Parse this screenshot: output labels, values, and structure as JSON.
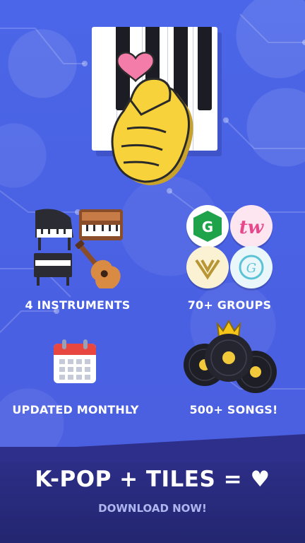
{
  "hero": {
    "icons": [
      "piano-keys-icon",
      "finger-heart-hand-icon",
      "pink-heart-icon"
    ]
  },
  "features": [
    {
      "label": "4 INSTRUMENTS",
      "icon": "instruments-icon"
    },
    {
      "label": "70+ GROUPS",
      "icon": "group-logos-icon"
    },
    {
      "label": "UPDATED MONTHLY",
      "icon": "calendar-icon"
    },
    {
      "label": "500+ SONGS!",
      "icon": "vinyl-records-crown-icon"
    }
  ],
  "banner": {
    "tagline": "K-POP + TILES = ♥",
    "cta": "DOWNLOAD NOW!"
  },
  "colors": {
    "background": "#4a64e6",
    "banner": "#2e2f8a",
    "heart": "#f47ca8",
    "hand": "#f7d23a",
    "cta_text": "#aeb6f0"
  }
}
